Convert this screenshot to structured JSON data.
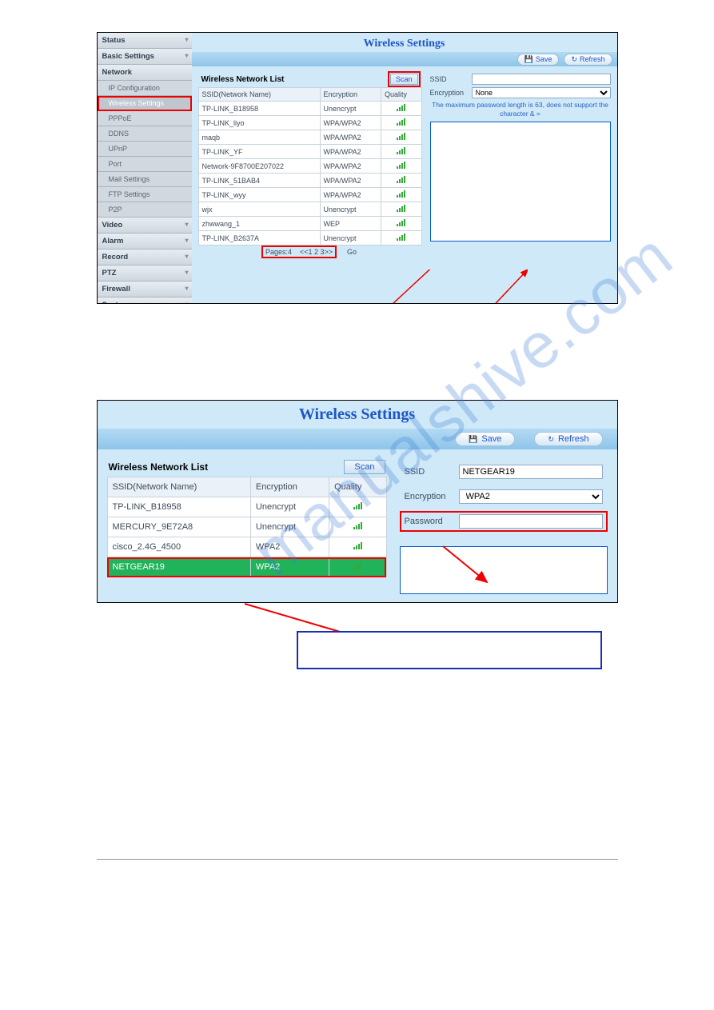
{
  "watermark": "manualshive.com",
  "panel1": {
    "sidebar": {
      "items": [
        {
          "label": "Status",
          "type": "main"
        },
        {
          "label": "Basic Settings",
          "type": "main"
        },
        {
          "label": "Network",
          "type": "main"
        },
        {
          "label": "IP Configuration",
          "type": "sub"
        },
        {
          "label": "Wireless Settings",
          "type": "sub",
          "active": true
        },
        {
          "label": "PPPoE",
          "type": "sub"
        },
        {
          "label": "DDNS",
          "type": "sub"
        },
        {
          "label": "UPnP",
          "type": "sub"
        },
        {
          "label": "Port",
          "type": "sub"
        },
        {
          "label": "Mail Settings",
          "type": "sub"
        },
        {
          "label": "FTP Settings",
          "type": "sub"
        },
        {
          "label": "P2P",
          "type": "sub"
        },
        {
          "label": "Video",
          "type": "main"
        },
        {
          "label": "Alarm",
          "type": "main"
        },
        {
          "label": "Record",
          "type": "main"
        },
        {
          "label": "PTZ",
          "type": "main"
        },
        {
          "label": "Firewall",
          "type": "main"
        },
        {
          "label": "System",
          "type": "main"
        }
      ]
    },
    "title": "Wireless Settings",
    "toolbar": {
      "save": "Save",
      "refresh": "Refresh"
    },
    "list": {
      "heading": "Wireless Network List",
      "scan": "Scan",
      "columns": [
        "SSID(Network Name)",
        "Encryption",
        "Quality"
      ],
      "rows": [
        {
          "ssid": "TP-LINK_B18958",
          "enc": "Unencrypt"
        },
        {
          "ssid": "TP-LINK_liyo",
          "enc": "WPA/WPA2"
        },
        {
          "ssid": "maqb",
          "enc": "WPA/WPA2"
        },
        {
          "ssid": "TP-LINK_YF",
          "enc": "WPA/WPA2"
        },
        {
          "ssid": "Network-9F8700E207022",
          "enc": "WPA/WPA2"
        },
        {
          "ssid": "TP-LINK_51BAB4",
          "enc": "WPA/WPA2"
        },
        {
          "ssid": "TP-LINK_wyy",
          "enc": "WPA/WPA2"
        },
        {
          "ssid": "wjx",
          "enc": "Unencrypt"
        },
        {
          "ssid": "zhwwang_1",
          "enc": "WEP"
        },
        {
          "ssid": "TP-LINK_B2637A",
          "enc": "Unencrypt"
        }
      ],
      "pager": {
        "prefix": "Pages:4",
        "links": "<<1 2 3>>",
        "go": "Go"
      }
    },
    "form": {
      "ssid_label": "SSID",
      "ssid_value": "",
      "enc_label": "Encryption",
      "enc_value": "None",
      "note": "The maximum password length is 63, does not support the character & ="
    }
  },
  "panel2": {
    "title": "Wireless Settings",
    "toolbar": {
      "save": "Save",
      "refresh": "Refresh"
    },
    "list": {
      "heading": "Wireless Network List",
      "scan": "Scan",
      "columns": [
        "SSID(Network Name)",
        "Encryption",
        "Quality"
      ],
      "rows": [
        {
          "ssid": "TP-LINK_B18958",
          "enc": "Unencrypt"
        },
        {
          "ssid": "MERCURY_9E72A8",
          "enc": "Unencrypt"
        },
        {
          "ssid": "cisco_2.4G_4500",
          "enc": "WPA2"
        },
        {
          "ssid": "NETGEAR19",
          "enc": "WPA2",
          "selected": true
        }
      ]
    },
    "form": {
      "ssid_label": "SSID",
      "ssid_value": "NETGEAR19",
      "enc_label": "Encryption",
      "enc_value": "WPA2",
      "pwd_label": "Password",
      "pwd_value": ""
    }
  }
}
